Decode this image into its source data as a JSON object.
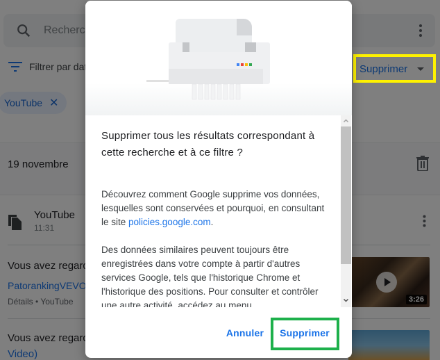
{
  "search": {
    "placeholder": "Rechercher",
    "icon": "search-icon",
    "more_icon": "more-vert-icon"
  },
  "filter": {
    "label": "Filtrer par date",
    "icon": "filter-list-icon"
  },
  "delete_menu": {
    "label": "Supprimer",
    "icon": "caret-down-icon"
  },
  "chip": {
    "label": "YouTube",
    "close_icon": "close-icon"
  },
  "date_group": {
    "label": "19 novembre",
    "icon": "trash-icon"
  },
  "entry": {
    "product": "YouTube",
    "time": "11:31",
    "icon": "copy-document-icon",
    "more_icon": "more-vert-icon"
  },
  "items": [
    {
      "title": "Vous avez regardé",
      "link": "PatorankingVEVO",
      "meta": "Détails • YouTube",
      "duration": "3:26"
    },
    {
      "title": "Vous avez regardé",
      "link": "Video)"
    }
  ],
  "dialog": {
    "illustration": "shredder-illustration",
    "title": "Supprimer tous les résultats correspondant à cette recherche et à ce filtre ?",
    "body1_prefix": "Découvrez comment Google supprime vos données, lesquelles sont conservées et pourquoi, en consultant le site ",
    "body1_link": "policies.google.com",
    "body1_suffix": ".",
    "body2": "Des données similaires peuvent toujours être enregistrées dans votre compte à partir d'autres services Google, tels que l'historique Chrome et l'historique des positions. Pour consulter et contrôler une autre activité, accédez au menu",
    "cancel_label": "Annuler",
    "confirm_label": "Supprimer"
  },
  "colors": {
    "accent": "#1a73e8",
    "highlight_yellow": "#fff200",
    "highlight_green": "#1db04b"
  }
}
